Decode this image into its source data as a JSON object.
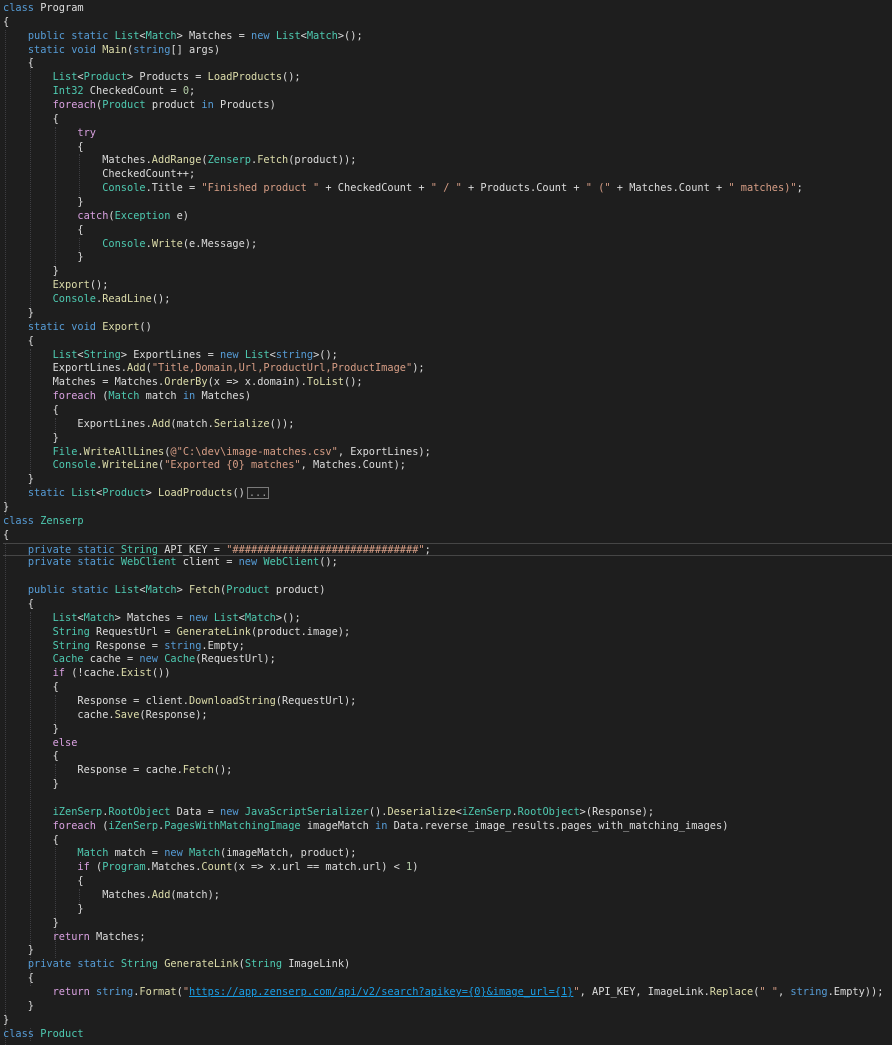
{
  "colors": {
    "background": "#1e1e1e",
    "default": "#dcdcdc",
    "keyword": "#569cd6",
    "control": "#d8a0df",
    "type": "#4ec9b0",
    "method": "#dcdcaa",
    "string": "#d69d85",
    "number": "#b5cea8",
    "url": "#1a9ee6"
  },
  "code_lines": [
    [
      [
        "class ",
        "k"
      ],
      [
        "Program",
        "d"
      ]
    ],
    [
      [
        "{",
        "d"
      ]
    ],
    [
      [
        "    ",
        "d"
      ],
      [
        "public static ",
        "k"
      ],
      [
        "List",
        "t"
      ],
      [
        "<",
        "d"
      ],
      [
        "Match",
        "t"
      ],
      [
        "> Matches = ",
        "d"
      ],
      [
        "new ",
        "k"
      ],
      [
        "List",
        "t"
      ],
      [
        "<",
        "d"
      ],
      [
        "Match",
        "t"
      ],
      [
        ">();",
        "d"
      ]
    ],
    [
      [
        "    ",
        "d"
      ],
      [
        "static void ",
        "k"
      ],
      [
        "Main",
        "m"
      ],
      [
        "(",
        "d"
      ],
      [
        "string",
        "k"
      ],
      [
        "[] ",
        "d"
      ],
      [
        "args",
        "d"
      ],
      [
        ")",
        "d"
      ]
    ],
    [
      [
        "    {",
        "d"
      ]
    ],
    [
      [
        "        ",
        "d"
      ],
      [
        "List",
        "t"
      ],
      [
        "<",
        "d"
      ],
      [
        "Product",
        "t"
      ],
      [
        "> Products = ",
        "d"
      ],
      [
        "LoadProducts",
        "m"
      ],
      [
        "();",
        "d"
      ]
    ],
    [
      [
        "        ",
        "d"
      ],
      [
        "Int32",
        "t"
      ],
      [
        " CheckedCount = ",
        "d"
      ],
      [
        "0",
        "n"
      ],
      [
        ";",
        "d"
      ]
    ],
    [
      [
        "        ",
        "d"
      ],
      [
        "foreach",
        "c"
      ],
      [
        "(",
        "d"
      ],
      [
        "Product",
        "t"
      ],
      [
        " product ",
        "d"
      ],
      [
        "in ",
        "k"
      ],
      [
        "Products)",
        "d"
      ]
    ],
    [
      [
        "        {",
        "d"
      ]
    ],
    [
      [
        "            ",
        "d"
      ],
      [
        "try",
        "c"
      ]
    ],
    [
      [
        "            {",
        "d"
      ]
    ],
    [
      [
        "                Matches.",
        "d"
      ],
      [
        "AddRange",
        "m"
      ],
      [
        "(",
        "d"
      ],
      [
        "Zenserp",
        "t"
      ],
      [
        ".",
        "d"
      ],
      [
        "Fetch",
        "m"
      ],
      [
        "(product));",
        "d"
      ]
    ],
    [
      [
        "                CheckedCount++;",
        "d"
      ]
    ],
    [
      [
        "                ",
        "d"
      ],
      [
        "Console",
        "t"
      ],
      [
        ".Title = ",
        "d"
      ],
      [
        "\"Finished product \"",
        "s"
      ],
      [
        " + CheckedCount + ",
        "d"
      ],
      [
        "\" / \"",
        "s"
      ],
      [
        " + Products.Count + ",
        "d"
      ],
      [
        "\" (\"",
        "s"
      ],
      [
        " + Matches.Count + ",
        "d"
      ],
      [
        "\" matches)\"",
        "s"
      ],
      [
        ";",
        "d"
      ]
    ],
    [
      [
        "            }",
        "d"
      ]
    ],
    [
      [
        "            ",
        "d"
      ],
      [
        "catch",
        "c"
      ],
      [
        "(",
        "d"
      ],
      [
        "Exception",
        "t"
      ],
      [
        " e)",
        "d"
      ]
    ],
    [
      [
        "            {",
        "d"
      ]
    ],
    [
      [
        "                ",
        "d"
      ],
      [
        "Console",
        "t"
      ],
      [
        ".",
        "d"
      ],
      [
        "Write",
        "m"
      ],
      [
        "(e.Message);",
        "d"
      ]
    ],
    [
      [
        "            }",
        "d"
      ]
    ],
    [
      [
        "        }",
        "d"
      ]
    ],
    [
      [
        "        ",
        "d"
      ],
      [
        "Export",
        "m"
      ],
      [
        "();",
        "d"
      ]
    ],
    [
      [
        "        ",
        "d"
      ],
      [
        "Console",
        "t"
      ],
      [
        ".",
        "d"
      ],
      [
        "ReadLine",
        "m"
      ],
      [
        "();",
        "d"
      ]
    ],
    [
      [
        "    }",
        "d"
      ]
    ],
    [
      [
        "    ",
        "d"
      ],
      [
        "static void ",
        "k"
      ],
      [
        "Export",
        "m"
      ],
      [
        "()",
        "d"
      ]
    ],
    [
      [
        "    {",
        "d"
      ]
    ],
    [
      [
        "        ",
        "d"
      ],
      [
        "List",
        "t"
      ],
      [
        "<",
        "d"
      ],
      [
        "String",
        "t"
      ],
      [
        "> ExportLines = ",
        "d"
      ],
      [
        "new ",
        "k"
      ],
      [
        "List",
        "t"
      ],
      [
        "<",
        "d"
      ],
      [
        "string",
        "k"
      ],
      [
        ">();",
        "d"
      ]
    ],
    [
      [
        "        ExportLines.",
        "d"
      ],
      [
        "Add",
        "m"
      ],
      [
        "(",
        "d"
      ],
      [
        "\"Title,Domain,Url,ProductUrl,ProductImage\"",
        "s"
      ],
      [
        ");",
        "d"
      ]
    ],
    [
      [
        "        Matches = Matches.",
        "d"
      ],
      [
        "OrderBy",
        "m"
      ],
      [
        "(x => x.domain).",
        "d"
      ],
      [
        "ToList",
        "m"
      ],
      [
        "();",
        "d"
      ]
    ],
    [
      [
        "        ",
        "d"
      ],
      [
        "foreach ",
        "c"
      ],
      [
        "(",
        "d"
      ],
      [
        "Match",
        "t"
      ],
      [
        " match ",
        "d"
      ],
      [
        "in ",
        "k"
      ],
      [
        "Matches)",
        "d"
      ]
    ],
    [
      [
        "        {",
        "d"
      ]
    ],
    [
      [
        "            ExportLines.",
        "d"
      ],
      [
        "Add",
        "m"
      ],
      [
        "(match.",
        "d"
      ],
      [
        "Serialize",
        "m"
      ],
      [
        "());",
        "d"
      ]
    ],
    [
      [
        "        }",
        "d"
      ]
    ],
    [
      [
        "        ",
        "d"
      ],
      [
        "File",
        "t"
      ],
      [
        ".",
        "d"
      ],
      [
        "WriteAllLines",
        "m"
      ],
      [
        "(",
        "d"
      ],
      [
        "@\"C:\\dev\\image-matches.csv\"",
        "s"
      ],
      [
        ", ExportLines);",
        "d"
      ]
    ],
    [
      [
        "        ",
        "d"
      ],
      [
        "Console",
        "t"
      ],
      [
        ".",
        "d"
      ],
      [
        "WriteLine",
        "m"
      ],
      [
        "(",
        "d"
      ],
      [
        "\"Exported {0} matches\"",
        "s"
      ],
      [
        ", Matches.Count);",
        "d"
      ]
    ],
    [
      [
        "    }",
        "d"
      ]
    ],
    [
      [
        "    ",
        "d"
      ],
      [
        "static ",
        "k"
      ],
      [
        "List",
        "t"
      ],
      [
        "<",
        "d"
      ],
      [
        "Product",
        "t"
      ],
      [
        "> ",
        "d"
      ],
      [
        "LoadProducts",
        "m"
      ],
      [
        "()",
        "d"
      ],
      [
        "...",
        "box"
      ]
    ],
    [
      [
        "}",
        "d"
      ]
    ],
    [
      [
        "class ",
        "k"
      ],
      [
        "Zenserp",
        "t"
      ]
    ],
    [
      [
        "{",
        "d"
      ]
    ],
    [
      [
        "    ",
        "d"
      ],
      [
        "private static ",
        "k"
      ],
      [
        "String",
        "t"
      ],
      [
        " API_KEY = ",
        "d"
      ],
      [
        "\"##############################\"",
        "s"
      ],
      [
        ";",
        "d"
      ]
    ],
    [
      [
        "    ",
        "d"
      ],
      [
        "private static ",
        "k"
      ],
      [
        "WebClient",
        "t"
      ],
      [
        " client = ",
        "d"
      ],
      [
        "new ",
        "k"
      ],
      [
        "WebClient",
        "t"
      ],
      [
        "();",
        "d"
      ]
    ],
    [
      [
        "",
        "d"
      ]
    ],
    [
      [
        "    ",
        "d"
      ],
      [
        "public static ",
        "k"
      ],
      [
        "List",
        "t"
      ],
      [
        "<",
        "d"
      ],
      [
        "Match",
        "t"
      ],
      [
        "> ",
        "d"
      ],
      [
        "Fetch",
        "m"
      ],
      [
        "(",
        "d"
      ],
      [
        "Product",
        "t"
      ],
      [
        " product)",
        "d"
      ]
    ],
    [
      [
        "    {",
        "d"
      ]
    ],
    [
      [
        "        ",
        "d"
      ],
      [
        "List",
        "t"
      ],
      [
        "<",
        "d"
      ],
      [
        "Match",
        "t"
      ],
      [
        "> Matches = ",
        "d"
      ],
      [
        "new ",
        "k"
      ],
      [
        "List",
        "t"
      ],
      [
        "<",
        "d"
      ],
      [
        "Match",
        "t"
      ],
      [
        ">();",
        "d"
      ]
    ],
    [
      [
        "        ",
        "d"
      ],
      [
        "String",
        "t"
      ],
      [
        " RequestUrl = ",
        "d"
      ],
      [
        "GenerateLink",
        "m"
      ],
      [
        "(product.image);",
        "d"
      ]
    ],
    [
      [
        "        ",
        "d"
      ],
      [
        "String",
        "t"
      ],
      [
        " Response = ",
        "d"
      ],
      [
        "string",
        "k"
      ],
      [
        ".Empty;",
        "d"
      ]
    ],
    [
      [
        "        ",
        "d"
      ],
      [
        "Cache",
        "t"
      ],
      [
        " cache = ",
        "d"
      ],
      [
        "new ",
        "k"
      ],
      [
        "Cache",
        "t"
      ],
      [
        "(RequestUrl);",
        "d"
      ]
    ],
    [
      [
        "        ",
        "d"
      ],
      [
        "if ",
        "c"
      ],
      [
        "(!cache.",
        "d"
      ],
      [
        "Exist",
        "m"
      ],
      [
        "())",
        "d"
      ]
    ],
    [
      [
        "        {",
        "d"
      ]
    ],
    [
      [
        "            Response = client.",
        "d"
      ],
      [
        "DownloadString",
        "m"
      ],
      [
        "(RequestUrl);",
        "d"
      ]
    ],
    [
      [
        "            cache.",
        "d"
      ],
      [
        "Save",
        "m"
      ],
      [
        "(Response);",
        "d"
      ]
    ],
    [
      [
        "        }",
        "d"
      ]
    ],
    [
      [
        "        ",
        "d"
      ],
      [
        "else",
        "c"
      ]
    ],
    [
      [
        "        {",
        "d"
      ]
    ],
    [
      [
        "            Response = cache.",
        "d"
      ],
      [
        "Fetch",
        "m"
      ],
      [
        "();",
        "d"
      ]
    ],
    [
      [
        "        }",
        "d"
      ]
    ],
    [
      [
        "",
        "d"
      ]
    ],
    [
      [
        "        ",
        "d"
      ],
      [
        "iZenSerp",
        "t"
      ],
      [
        ".",
        "d"
      ],
      [
        "RootObject",
        "t"
      ],
      [
        " Data = ",
        "d"
      ],
      [
        "new ",
        "k"
      ],
      [
        "JavaScriptSerializer",
        "t"
      ],
      [
        "().",
        "d"
      ],
      [
        "Deserialize",
        "m"
      ],
      [
        "<",
        "d"
      ],
      [
        "iZenSerp",
        "t"
      ],
      [
        ".",
        "d"
      ],
      [
        "RootObject",
        "t"
      ],
      [
        ">(Response);",
        "d"
      ]
    ],
    [
      [
        "        ",
        "d"
      ],
      [
        "foreach ",
        "c"
      ],
      [
        "(",
        "d"
      ],
      [
        "iZenSerp",
        "t"
      ],
      [
        ".",
        "d"
      ],
      [
        "PagesWithMatchingImage",
        "t"
      ],
      [
        " imageMatch ",
        "d"
      ],
      [
        "in ",
        "k"
      ],
      [
        "Data.reverse_image_results.pages_with_matching_images)",
        "d"
      ]
    ],
    [
      [
        "        {",
        "d"
      ]
    ],
    [
      [
        "            ",
        "d"
      ],
      [
        "Match",
        "t"
      ],
      [
        " match = ",
        "d"
      ],
      [
        "new ",
        "k"
      ],
      [
        "Match",
        "t"
      ],
      [
        "(imageMatch, product);",
        "d"
      ]
    ],
    [
      [
        "            ",
        "d"
      ],
      [
        "if ",
        "c"
      ],
      [
        "(",
        "d"
      ],
      [
        "Program",
        "t"
      ],
      [
        ".Matches.",
        "d"
      ],
      [
        "Count",
        "m"
      ],
      [
        "(x => x.url == match.url) < ",
        "d"
      ],
      [
        "1",
        "n"
      ],
      [
        ")",
        "d"
      ]
    ],
    [
      [
        "            {",
        "d"
      ]
    ],
    [
      [
        "                Matches.",
        "d"
      ],
      [
        "Add",
        "m"
      ],
      [
        "(match);",
        "d"
      ]
    ],
    [
      [
        "            }",
        "d"
      ]
    ],
    [
      [
        "        }",
        "d"
      ]
    ],
    [
      [
        "        ",
        "d"
      ],
      [
        "return ",
        "c"
      ],
      [
        "Matches;",
        "d"
      ]
    ],
    [
      [
        "    }",
        "d"
      ]
    ],
    [
      [
        "    ",
        "d"
      ],
      [
        "private static ",
        "k"
      ],
      [
        "String",
        "t"
      ],
      [
        " ",
        "d"
      ],
      [
        "GenerateLink",
        "m"
      ],
      [
        "(",
        "d"
      ],
      [
        "String",
        "t"
      ],
      [
        " ImageLink)",
        "d"
      ]
    ],
    [
      [
        "    {",
        "d"
      ]
    ],
    [
      [
        "        ",
        "d"
      ],
      [
        "return ",
        "c"
      ],
      [
        "string",
        "k"
      ],
      [
        ".",
        "d"
      ],
      [
        "Format",
        "m"
      ],
      [
        "(",
        "d"
      ],
      [
        "\"",
        "s"
      ],
      [
        "https://app.zenserp.com/api/v2/search?apikey={0}&image_url={1}",
        "u"
      ],
      [
        "\"",
        "s"
      ],
      [
        ", API_KEY, ImageLink.",
        "d"
      ],
      [
        "Replace",
        "m"
      ],
      [
        "(",
        "d"
      ],
      [
        "\" \"",
        "s"
      ],
      [
        ", ",
        "d"
      ],
      [
        "string",
        "k"
      ],
      [
        ".Empty));",
        "d"
      ]
    ],
    [
      [
        "    }",
        "d"
      ]
    ],
    [
      [
        "}",
        "d"
      ]
    ],
    [
      [
        "class ",
        "k"
      ],
      [
        "Product",
        "t"
      ]
    ]
  ]
}
